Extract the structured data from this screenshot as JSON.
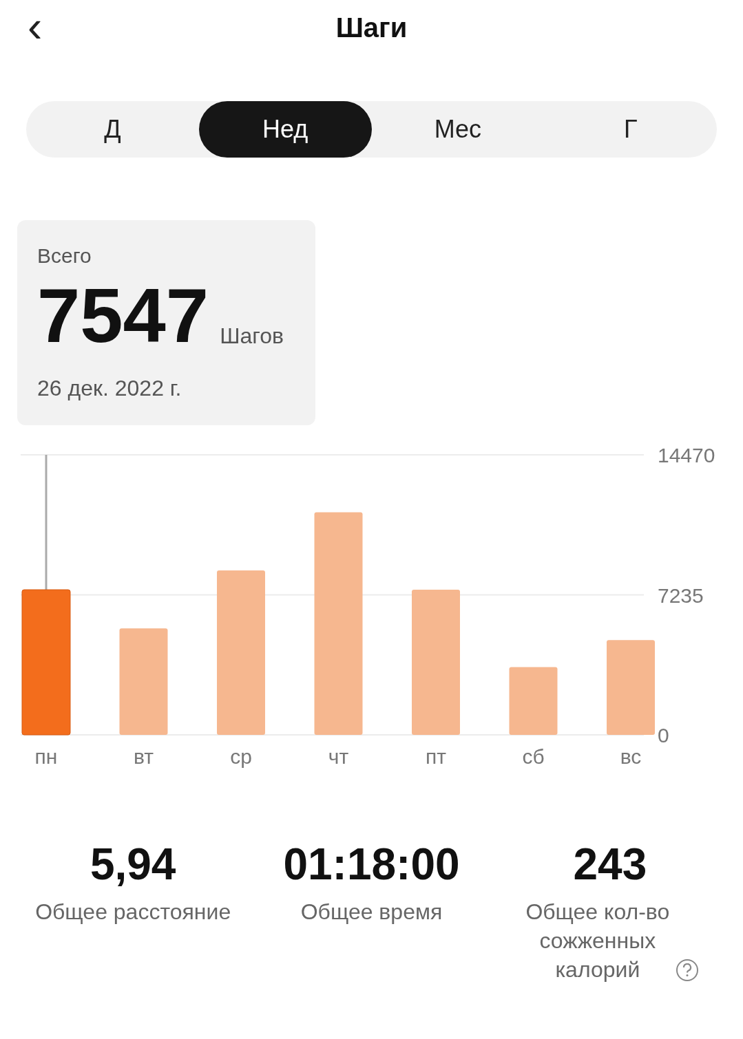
{
  "header": {
    "back": "‹",
    "title": "Шаги"
  },
  "tabs": [
    {
      "label": "Д",
      "selected": false
    },
    {
      "label": "Нед",
      "selected": true
    },
    {
      "label": "Мес",
      "selected": false
    },
    {
      "label": "Г",
      "selected": false
    }
  ],
  "summary": {
    "label": "Всего",
    "value": "7547",
    "unit": "Шагов",
    "date": "26 дек. 2022 г."
  },
  "chart": {
    "bars": [
      {
        "selected": true,
        "color": "#f36d1c"
      },
      {
        "selected": false,
        "color": "#f6b78f"
      },
      {
        "selected": false,
        "color": "#f6b78f"
      },
      {
        "selected": false,
        "color": "#f6b78f"
      },
      {
        "selected": false,
        "color": "#f6b78f"
      },
      {
        "selected": false,
        "color": "#f6b78f"
      },
      {
        "selected": false,
        "color": "#f6b78f"
      }
    ],
    "chart_data": {
      "type": "bar",
      "categories": [
        "пн",
        "вт",
        "ср",
        "чт",
        "пт",
        "сб",
        "вс"
      ],
      "values": [
        7500,
        5500,
        8500,
        11500,
        7500,
        3500,
        4900
      ],
      "ylim": [
        0,
        14470
      ],
      "yticks": [
        0,
        7235,
        14470
      ]
    }
  },
  "stats": [
    {
      "value": "5,94",
      "label": "Общее расстояние"
    },
    {
      "value": "01:18:00",
      "label": "Общее время"
    },
    {
      "value": "243",
      "label": "Общее кол-во сожженных калорий",
      "help": true
    }
  ]
}
